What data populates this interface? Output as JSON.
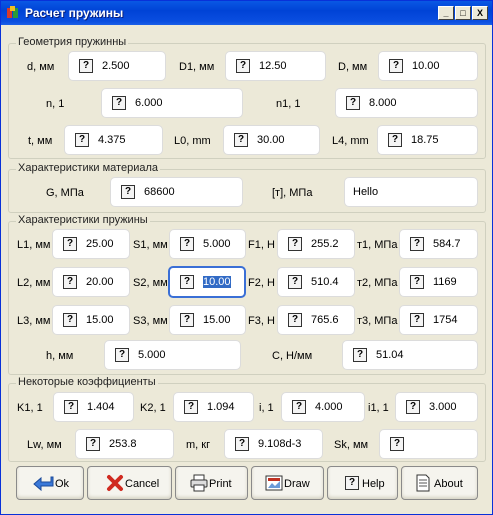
{
  "window": {
    "title": "Расчет пружины",
    "minimize": "_",
    "maximize": "□",
    "close": "X"
  },
  "geometry": {
    "title": "Геометрия пружинны",
    "d": {
      "label": "d, мм",
      "value": "2.500"
    },
    "D1": {
      "label": "D1, мм",
      "value": "12.50"
    },
    "D": {
      "label": "D, мм",
      "value": "10.00"
    },
    "n": {
      "label": "n, 1",
      "value": "6.000"
    },
    "n1": {
      "label": "n1, 1",
      "value": "8.000"
    },
    "t": {
      "label": "t, мм",
      "value": "4.375"
    },
    "L0": {
      "label": "L0, mm",
      "value": "30.00"
    },
    "L4": {
      "label": "L4, mm",
      "value": "18.75"
    }
  },
  "material": {
    "title": "Характеристики материала",
    "G": {
      "label": "G, МПа",
      "value": "68600"
    },
    "tau": {
      "label": "[т], МПа",
      "value": "Hello"
    }
  },
  "spring": {
    "title": "Характеристики пружины",
    "L1": {
      "label": "L1, мм",
      "value": "25.00"
    },
    "S1": {
      "label": "S1, мм",
      "value": "5.000"
    },
    "F1": {
      "label": "F1, Н",
      "value": "255.2"
    },
    "t1": {
      "label": "т1, МПа",
      "value": "584.7"
    },
    "L2": {
      "label": "L2, мм",
      "value": "20.00"
    },
    "S2": {
      "label": "S2, мм",
      "value": "10.00"
    },
    "F2": {
      "label": "F2, Н",
      "value": "510.4"
    },
    "t2": {
      "label": "т2, МПа",
      "value": "1169"
    },
    "L3": {
      "label": "L3, мм",
      "value": "15.00"
    },
    "S3": {
      "label": "S3, мм",
      "value": "15.00"
    },
    "F3": {
      "label": "F3, Н",
      "value": "765.6"
    },
    "t3": {
      "label": "т3, МПа",
      "value": "1754"
    },
    "h": {
      "label": "h, мм",
      "value": "5.000"
    },
    "C": {
      "label": "C, Н/мм",
      "value": "51.04"
    }
  },
  "coeffs": {
    "title": "Некоторые коэффициенты",
    "K1": {
      "label": "K1, 1",
      "value": "1.404"
    },
    "K2": {
      "label": "K2, 1",
      "value": "1.094"
    },
    "i": {
      "label": "i, 1",
      "value": "4.000"
    },
    "i1": {
      "label": "i1, 1",
      "value": "3.000"
    },
    "Lw": {
      "label": "Lw, мм",
      "value": "253.8"
    },
    "m": {
      "label": "m, кг",
      "value": "9.108d-3"
    },
    "Sk": {
      "label": "Sk, мм",
      "value": ""
    }
  },
  "question_glyph": "?",
  "buttons": {
    "ok": "Ok",
    "cancel": "Cancel",
    "print": "Print",
    "draw": "Draw",
    "help": "Help",
    "about": "About"
  }
}
